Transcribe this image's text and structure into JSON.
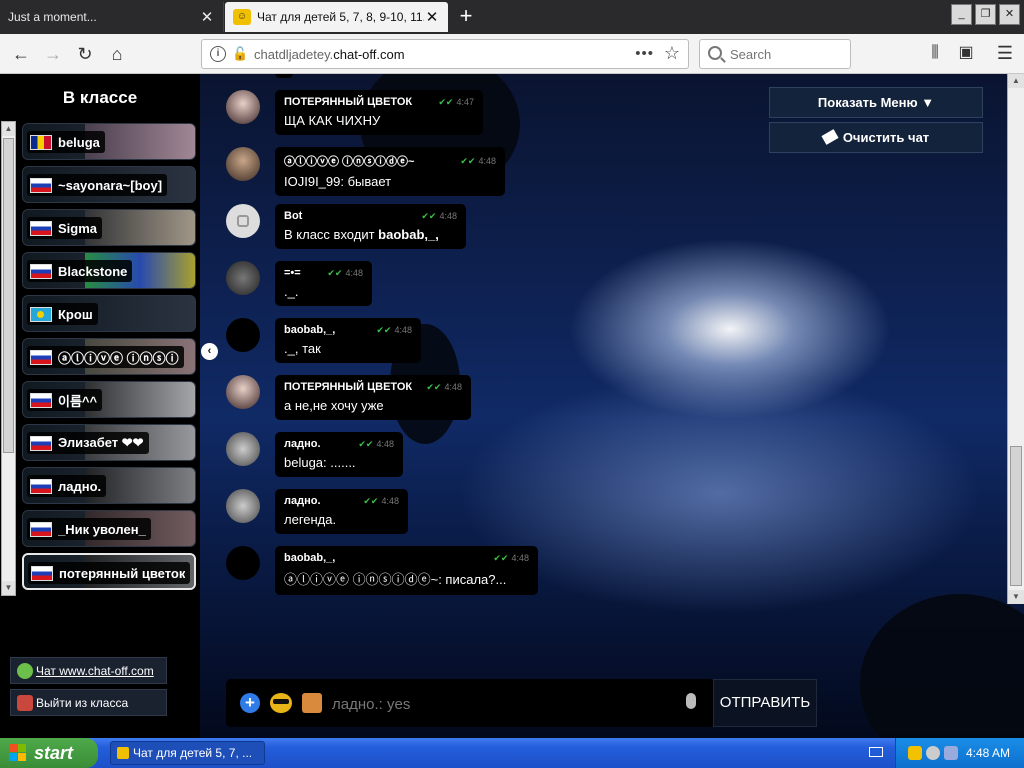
{
  "browser": {
    "tabs": [
      {
        "title": "Just a moment...",
        "active": false
      },
      {
        "title": "Чат для детей 5, 7, 8, 9-10, 11...",
        "active": true
      }
    ],
    "url_domain": "chatdljadetey.",
    "url_host": "chat-off.com",
    "search_placeholder": "Search"
  },
  "sidebar": {
    "title": "В классе",
    "users": [
      {
        "name": "beluga",
        "flag": "ro"
      },
      {
        "name": "~sayonara~[boy]",
        "flag": "ru"
      },
      {
        "name": "Sigma",
        "flag": "ru"
      },
      {
        "name": "Blackstone",
        "flag": "ru"
      },
      {
        "name": "Крош",
        "flag": "kz"
      },
      {
        "name": "ⓐⓛⓘⓥⓔ ⓘⓝⓢⓘ",
        "flag": "ru"
      },
      {
        "name": "이름^^",
        "flag": "ru"
      },
      {
        "name": "Элизабет ❤❤",
        "flag": "ru"
      },
      {
        "name": "ладно.",
        "flag": "ru"
      },
      {
        "name": "_Ник уволен_",
        "flag": "ru"
      },
      {
        "name": "потерянный цветок",
        "flag": "ru"
      }
    ],
    "links": [
      {
        "label": "Чат www.chat-off.com"
      },
      {
        "label": "Выйти из класса"
      }
    ]
  },
  "header_buttons": {
    "menu_label": "Показать Меню ▼",
    "clear_label": "Очистить чат"
  },
  "messages": [
    {
      "author": "ПОТЕРЯННЫЙ ЦВЕТОК",
      "time": "4:47",
      "text": "ЩА КАК ЧИХНУ"
    },
    {
      "author": "ⓐⓛⓘⓥⓔ ⓘⓝⓢⓘⓓⓔ~",
      "time": "4:48",
      "text": "IOJI9I_99: бывает"
    },
    {
      "author": "Bot",
      "time": "4:48",
      "text_pre": "В класс входит ",
      "text_bold": "baobab,_,"
    },
    {
      "author": "=•=",
      "time": "4:48",
      "text": "._."
    },
    {
      "author": "baobab,_,",
      "time": "4:48",
      "text": "._, так"
    },
    {
      "author": "ПОТЕРЯННЫЙ ЦВЕТОК",
      "time": "4:48",
      "text": "а не,не хочу уже"
    },
    {
      "author": "ладно.",
      "time": "4:48",
      "text": "beluga: ......."
    },
    {
      "author": "ладно.",
      "time": "4:48",
      "text": "легенда."
    },
    {
      "author": "baobab,_,",
      "time": "4:48",
      "text": "ⓐⓛⓘⓥⓔ ⓘⓝⓢⓘⓓⓔ~: писала?..."
    }
  ],
  "input": {
    "value": "ладно.: yes",
    "send_label": "ОТПРАВИТЬ"
  },
  "taskbar": {
    "start_label": "start",
    "task_label": "Чат для детей 5, 7, ...",
    "clock": "4:48 AM"
  },
  "colors": {
    "tick_green": "#3bc24a",
    "button_navy": "#14233c",
    "night_blue": "#102a66"
  }
}
